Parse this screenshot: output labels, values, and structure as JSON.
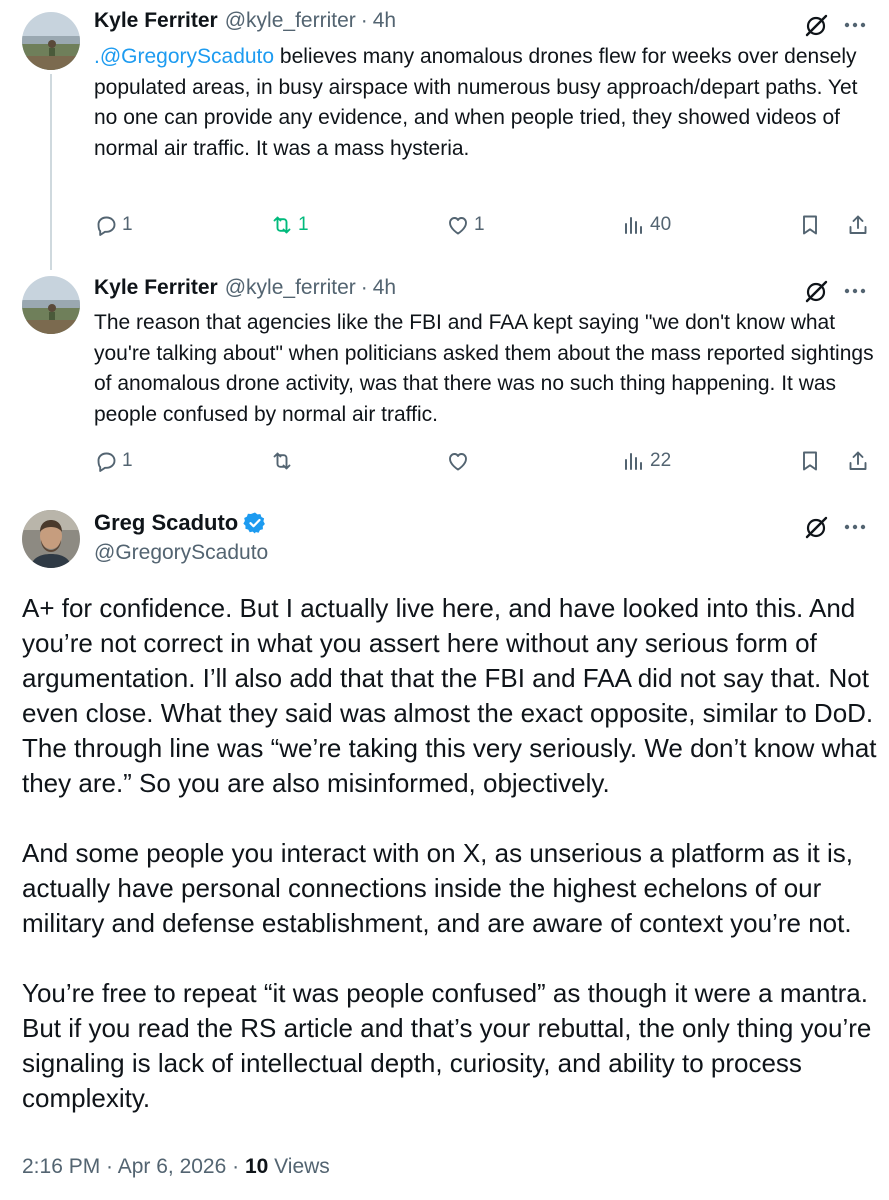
{
  "reply1": {
    "author_name": "Kyle Ferriter",
    "handle": "@kyle_ferriter",
    "separator": "·",
    "time": "4h",
    "mention": ".@GregoryScaduto",
    "text": " believes many anomalous drones flew for weeks over densely populated areas, in busy airspace with numerous busy approach/depart paths. Yet no one can provide any evidence, and when people tried, they showed videos of normal air traffic. It was a mass hysteria.",
    "actions": {
      "replies": "1",
      "reposts": "1",
      "likes": "1",
      "views": "40"
    }
  },
  "reply2": {
    "author_name": "Kyle Ferriter",
    "handle": "@kyle_ferriter",
    "separator": "·",
    "time": "4h",
    "text": "The reason that agencies like the FBI and FAA kept saying \"we don't know what you're talking about\" when politicians asked them about the mass reported sightings of anomalous drone activity, was that there was no such thing happening. It was people confused by normal air traffic.",
    "actions": {
      "replies": "1",
      "reposts": "",
      "likes": "",
      "views": "22"
    }
  },
  "main_tweet": {
    "author_name": "Greg Scaduto",
    "handle": "@GregoryScaduto",
    "paragraphs": [
      "A+ for confidence. But I actually live here, and have looked into this. And you’re not correct in what you assert here without any serious form of argumentation. I’ll also add that that the FBI and FAA did not say that. Not even close. What they said was almost the exact opposite, similar to DoD. The through line was “we’re taking this very seriously. We don’t know what they are.” So you are also misinformed, objectively.",
      "And some people you interact with on X, as unserious a platform as it is, actually have personal connections inside the highest echelons of our military and defense establishment, and are aware of context you’re not.",
      "You’re free to repeat “it was people confused” as though it were a mantra. But if you read the RS article and that’s your rebuttal, the only thing you’re signaling is lack of intellectual depth, curiosity, and ability to process complexity."
    ],
    "timestamp": "2:16 PM · Apr 6, 2026 · ",
    "views_count": "10",
    "views_label": " Views"
  },
  "icons": {
    "grok": "grok-icon",
    "more": "more-dots-icon",
    "reply": "reply-bubble-icon",
    "repost": "repost-icon",
    "like": "heart-icon",
    "views": "analytics-bars-icon",
    "bookmark": "bookmark-icon",
    "share": "share-icon",
    "verified": "verified-badge-icon"
  },
  "colors": {
    "text": "#0f1419",
    "secondary": "#536471",
    "link": "#1d9bf0",
    "repost_active": "#00ba7c",
    "verified": "#1d9bf0",
    "thread_line": "#cfd9de"
  }
}
